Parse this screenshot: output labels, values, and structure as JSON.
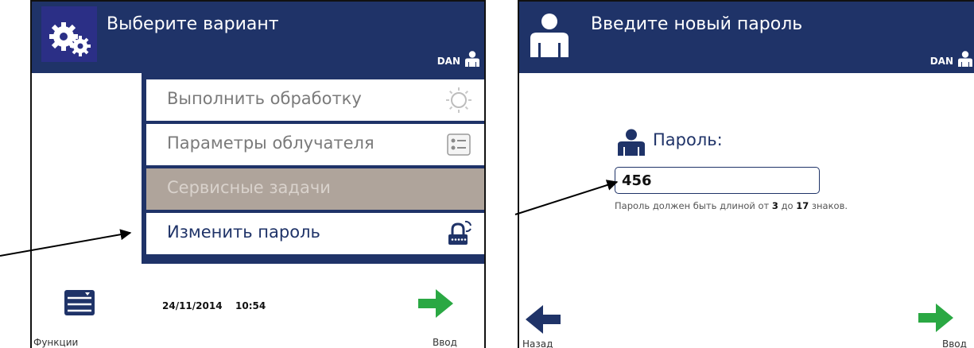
{
  "left_screen": {
    "title": "Выберите вариант",
    "user": "DAN",
    "menu": [
      {
        "label": "Выполнить обработку",
        "icon": "sun-icon",
        "state": "normal"
      },
      {
        "label": "Параметры облучателя",
        "icon": "settings-list-icon",
        "state": "normal"
      },
      {
        "label": "Сервисные задачи",
        "icon": "",
        "state": "disabled"
      },
      {
        "label": "Изменить пароль",
        "icon": "lock-refresh-icon",
        "state": "active"
      }
    ],
    "date": "24/11/2014",
    "time": "10:54",
    "functions_label": "Функции",
    "enter_label": "Ввод"
  },
  "right_screen": {
    "title": "Введите новый пароль",
    "user": "DAN",
    "password_label": "Пароль:",
    "password_value": "456",
    "hint_prefix": "Пароль должен быть длиной от ",
    "hint_min": "3",
    "hint_mid": " до ",
    "hint_max": "17",
    "hint_suffix": " знаков.",
    "back_label": "Назад",
    "enter_label": "Ввод"
  },
  "colors": {
    "header": "#1f3368",
    "accent_green": "#2aa843",
    "disabled_item": "#afa49b"
  }
}
